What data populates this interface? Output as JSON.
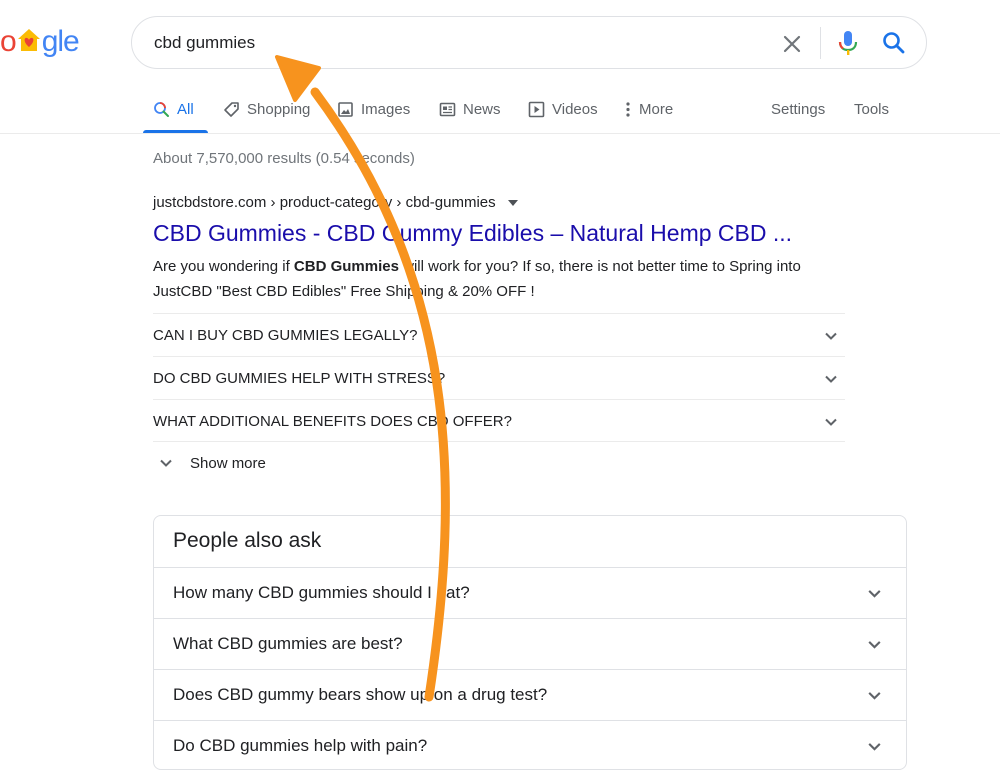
{
  "logo": {
    "part1": "o",
    "part2": "gle",
    "icon": "house-heart-icon"
  },
  "search": {
    "query": "cbd gummies",
    "clear_icon": "close-icon",
    "mic_icon": "microphone-icon",
    "search_icon": "search-icon"
  },
  "tabs": {
    "items": [
      {
        "label": "All",
        "icon": "search-icon",
        "active": true
      },
      {
        "label": "Shopping",
        "icon": "tag-icon"
      },
      {
        "label": "Images",
        "icon": "image-icon"
      },
      {
        "label": "News",
        "icon": "newspaper-icon"
      },
      {
        "label": "Videos",
        "icon": "play-icon"
      },
      {
        "label": "More",
        "icon": "more-vertical-icon"
      }
    ],
    "settings": "Settings",
    "tools": "Tools"
  },
  "results": {
    "stats": "About 7,570,000 results (0.54 seconds)",
    "first": {
      "cite": "justcbdstore.com › product-category › cbd-gummies",
      "title": "CBD Gummies - CBD Gummy Edibles – Natural Hemp CBD ...",
      "snippet_before": "Are you wondering if ",
      "snippet_bold": "CBD Gummies",
      "snippet_after": " will work for you? If so, there is not better time to Spring into JustCBD \"Best CBD Edibles\" Free Shipping & 20% OFF !",
      "faqs": [
        "CAN I BUY CBD GUMMIES LEGALLY?",
        "DO CBD GUMMIES HELP WITH STRESS?",
        "WHAT ADDITIONAL BENEFITS DOES CBD OFFER?"
      ],
      "show_more": "Show more"
    }
  },
  "people_also_ask": {
    "title": "People also ask",
    "questions": [
      "How many CBD gummies should I eat?",
      "What CBD gummies are best?",
      "Does CBD gummy bears show up on a drug test?",
      "Do CBD gummies help with pain?"
    ]
  },
  "annotation": {
    "arrow_color": "#f7931e"
  },
  "colors": {
    "link": "#1a0dab",
    "accent": "#1a73e8",
    "muted": "#70757a"
  }
}
